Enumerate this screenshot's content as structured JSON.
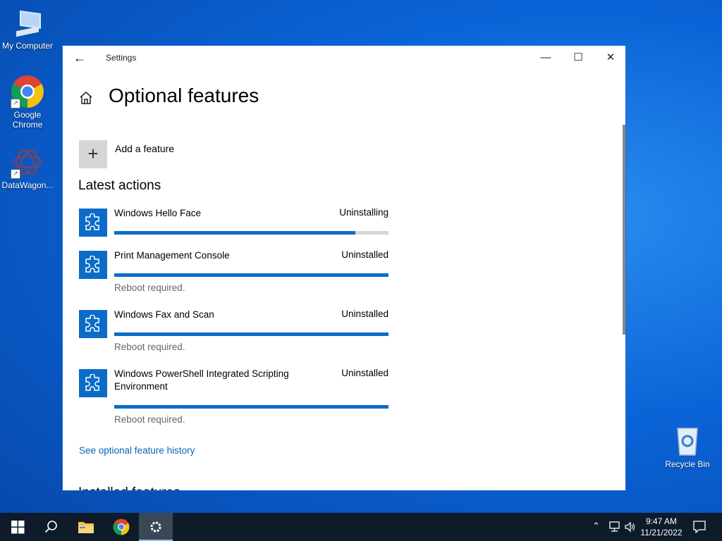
{
  "desktop": {
    "icons": [
      {
        "label": "My Computer",
        "icon": "computer-icon"
      },
      {
        "label": "Google Chrome",
        "icon": "chrome-icon"
      },
      {
        "label": "DataWagon...",
        "icon": "datawagon-icon"
      },
      {
        "label": "Recycle Bin",
        "icon": "recycle-bin-icon"
      }
    ]
  },
  "window": {
    "title": "Settings",
    "controls": {
      "minimize": "—",
      "maximize": "☐",
      "close": "✕"
    }
  },
  "page": {
    "title": "Optional features",
    "add_feature_label": "Add a feature",
    "section_heading": "Latest actions",
    "history_link": "See optional feature history",
    "next_heading": "Installed features"
  },
  "actions": [
    {
      "name": "Windows Hello Face",
      "status": "Uninstalling",
      "progress": 0.88,
      "note": ""
    },
    {
      "name": "Print Management Console",
      "status": "Uninstalled",
      "progress": 1.0,
      "note": "Reboot required."
    },
    {
      "name": "Windows Fax and Scan",
      "status": "Uninstalled",
      "progress": 1.0,
      "note": "Reboot required."
    },
    {
      "name": "Windows PowerShell Integrated Scripting Environment",
      "status": "Uninstalled",
      "progress": 1.0,
      "note": "Reboot required."
    }
  ],
  "taskbar": {
    "clock_time": "9:47 AM",
    "clock_date": "11/21/2022",
    "items": [
      "start-icon",
      "search-icon",
      "file-explorer-icon",
      "chrome-icon",
      "settings-icon"
    ]
  },
  "colors": {
    "accent": "#0b6cc8",
    "link": "#0b63b8",
    "taskbar": "#0d1b2a"
  }
}
